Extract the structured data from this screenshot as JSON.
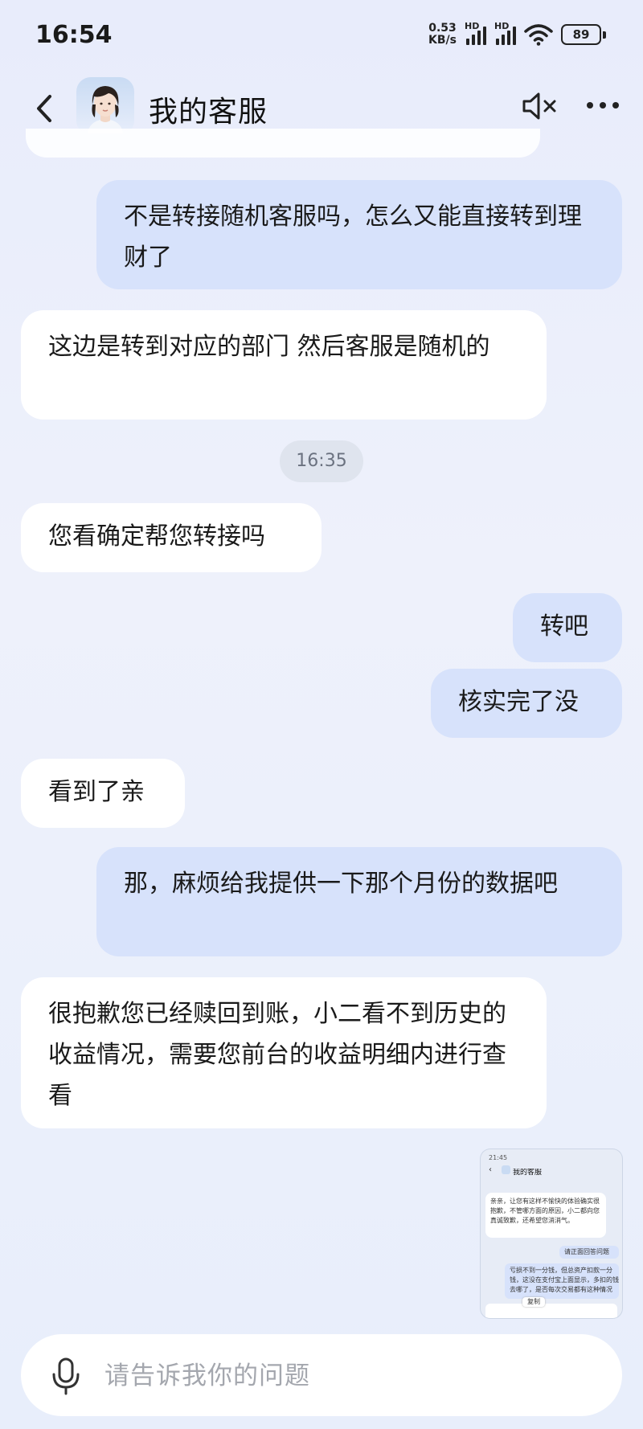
{
  "status": {
    "time": "16:54",
    "speed_value": "0.53",
    "speed_unit": "KB/s",
    "sim1": "HD",
    "sim2": "HD",
    "battery": "89"
  },
  "header": {
    "title": "我的客服"
  },
  "timestamp": "16:35",
  "messages": [
    {
      "side": "out",
      "text": "不是转接随机客服吗，怎么又能直接转到理财了"
    },
    {
      "side": "in",
      "text": "这边是转到对应的部门 然后客服是随机的"
    },
    {
      "side": "in",
      "text": "您看确定帮您转接吗"
    },
    {
      "side": "out",
      "text": "转吧"
    },
    {
      "side": "out",
      "text": "核实完了没"
    },
    {
      "side": "in",
      "text": "看到了亲"
    },
    {
      "side": "out",
      "text": "那，麻烦给我提供一下那个月份的数据吧"
    },
    {
      "side": "in",
      "text": "很抱歉您已经赎回到账，小二看不到历史的收益情况，需要您前台的收益明细内进行查看"
    }
  ],
  "thumbnail": {
    "time": "21:45",
    "title": "我的客服",
    "lines": [
      "亲亲，让您有这样不愉快的体验确实很",
      "抱歉，不管哪方面的原因，小二都向您",
      "真诚致歉，还希望您消消气。",
      "请正面回答问题",
      "亏损不到一分钱，但总资产扣款一分",
      "钱，这没在支付宝上面显示，多扣的钱",
      "去哪了，是否每次交易都有这种情况",
      "复制"
    ]
  },
  "input": {
    "placeholder": "请告诉我你的问题"
  }
}
